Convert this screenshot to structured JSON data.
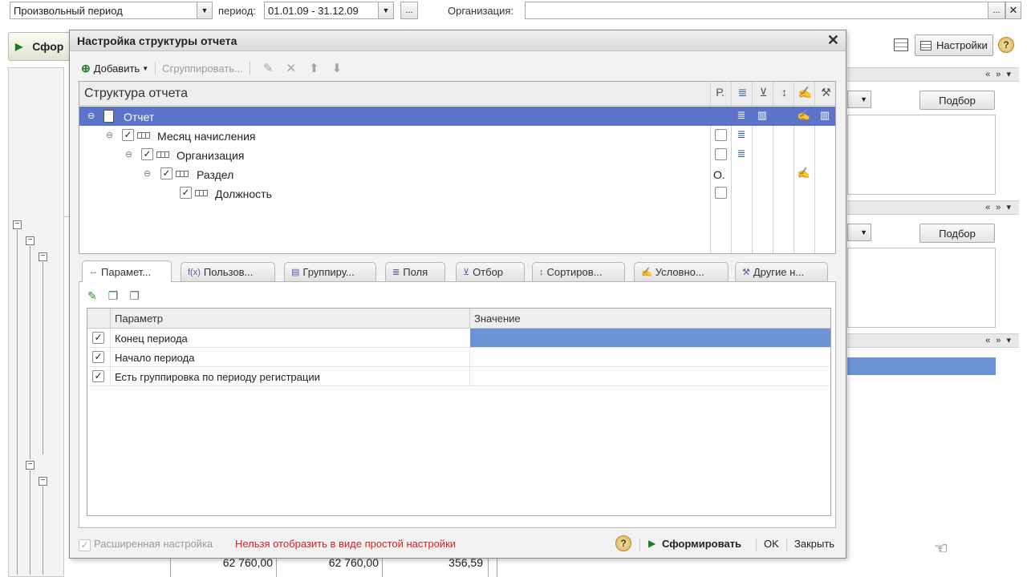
{
  "topbar": {
    "period_type": "Произвольный период",
    "period_label": "период:",
    "period_value": "01.01.09 - 31.12.09",
    "dots": "...",
    "org_label": "Организация:",
    "org_value": "",
    "org_dots": "..."
  },
  "main": {
    "generate_label": "Сфор",
    "settings_label": "Настройки",
    "help": "?",
    "podbor1": "Подбор",
    "podbor2": "Подбор",
    "nav_arrows": "« » ▾"
  },
  "bg_table": {
    "row1": [
      "62 760,00",
      "62 760,00",
      "356,59"
    ]
  },
  "dialog": {
    "title": "Настройка структуры отчета",
    "close": "✕",
    "toolbar": {
      "add": "Добавить",
      "group": "Сгруппировать..."
    },
    "structure": {
      "header": "Структура отчета",
      "col_r": "Р.",
      "rows": [
        {
          "label": "Отчет",
          "r": ""
        },
        {
          "label": "Месяц начисления",
          "r": ""
        },
        {
          "label": "Организация",
          "r": ""
        },
        {
          "label": "Раздел",
          "r": "О."
        },
        {
          "label": "Должность",
          "r": ""
        }
      ]
    },
    "tabs": [
      {
        "label": "Парамет...",
        "icon": "params-icon"
      },
      {
        "label": "Пользов...",
        "icon": "user-fields-icon"
      },
      {
        "label": "Группиру...",
        "icon": "grouping-icon"
      },
      {
        "label": "Поля",
        "icon": "fields-icon"
      },
      {
        "label": "Отбор",
        "icon": "filter-icon"
      },
      {
        "label": "Сортиров...",
        "icon": "sort-icon"
      },
      {
        "label": "Условно...",
        "icon": "conditional-icon"
      },
      {
        "label": "Другие н...",
        "icon": "other-settings-icon"
      }
    ],
    "params_table": {
      "col_param": "Параметр",
      "col_value": "Значение",
      "rows": [
        {
          "name": "Конец периода",
          "value": "",
          "checked": true
        },
        {
          "name": "Начало периода",
          "value": "",
          "checked": true
        },
        {
          "name": "Есть группировка по периоду регистрации",
          "value": "",
          "checked": true
        }
      ]
    },
    "footer": {
      "extended": "Расширенная настройка",
      "warning": "Нельзя отобразить в виде простой настройки",
      "help": "?",
      "generate": "Сформировать",
      "ok": "OK",
      "close": "Закрыть"
    }
  },
  "colors": {
    "selection": "#5b73c8",
    "value_highlight": "#6b93d6",
    "warning": "#d62020"
  }
}
